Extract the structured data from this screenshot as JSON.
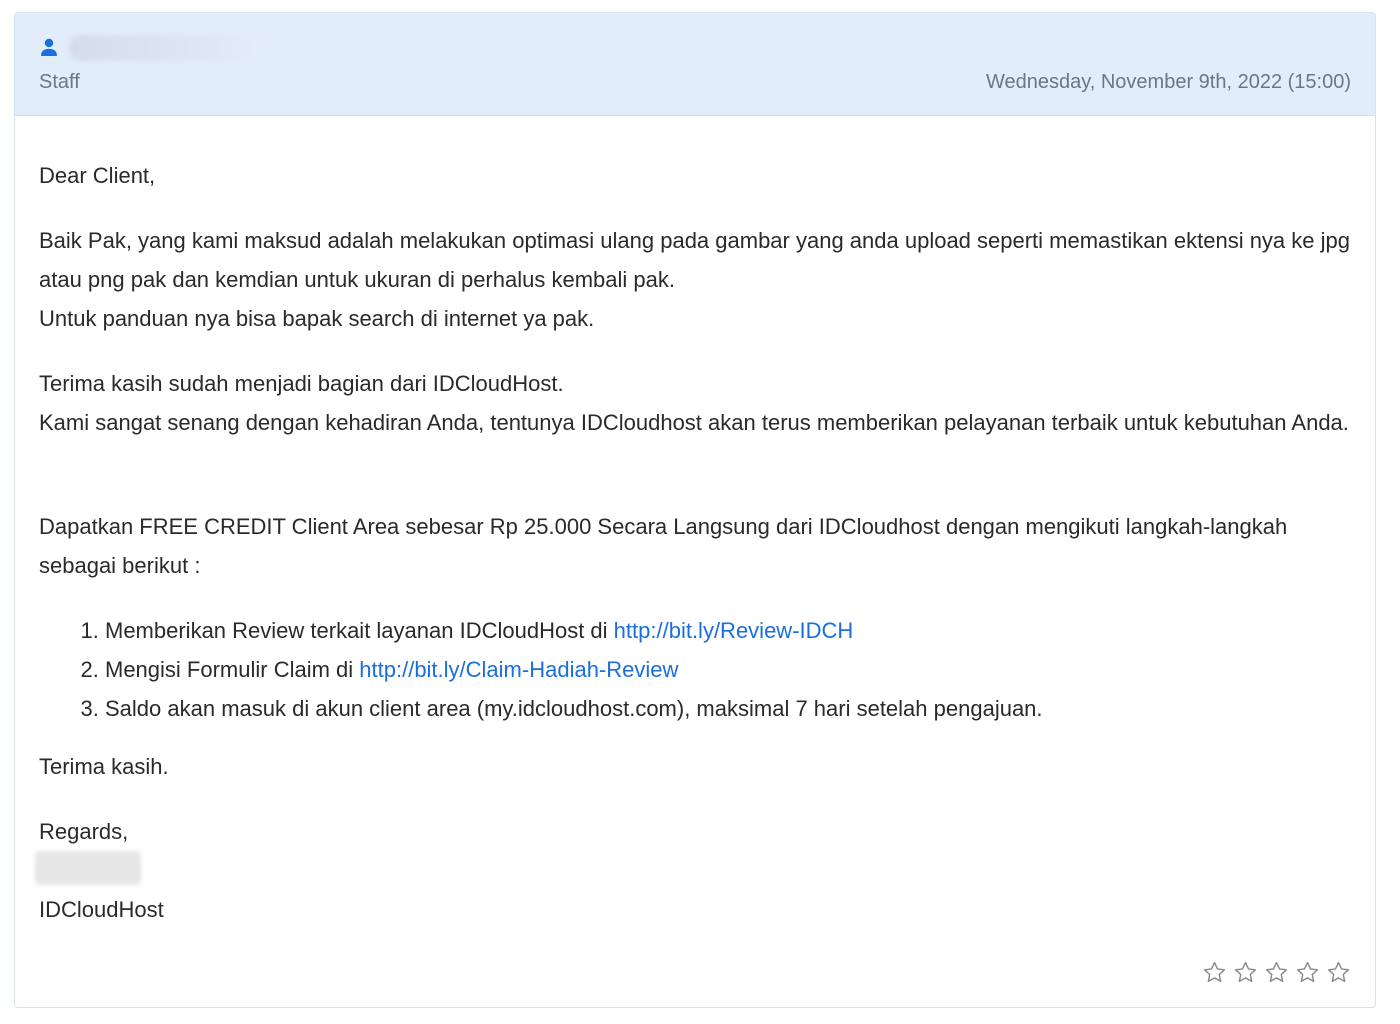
{
  "header": {
    "role": "Staff",
    "timestamp": "Wednesday, November 9th, 2022 (15:00)"
  },
  "message": {
    "greeting": "Dear Client,",
    "para1_line1": "Baik Pak, yang kami maksud adalah melakukan optimasi ulang pada gambar yang anda upload seperti memastikan ektensi nya ke jpg atau png pak dan kemdian untuk ukuran di perhalus kembali pak.",
    "para1_line2": "Untuk panduan nya bisa bapak search di internet ya pak.",
    "para2_line1": "Terima kasih sudah menjadi bagian dari IDCloudHost.",
    "para2_line2": "Kami sangat senang dengan kehadiran Anda, tentunya IDCloudhost akan terus memberikan pelayanan terbaik untuk kebutuhan Anda.",
    "para3": "Dapatkan FREE CREDIT Client Area sebesar Rp 25.000 Secara Langsung dari IDCloudhost dengan mengikuti langkah-langkah sebagai berikut :",
    "steps": [
      {
        "text": "Memberikan Review terkait layanan IDCloudHost di ",
        "link": "http://bit.ly/Review-IDCH"
      },
      {
        "text": "Mengisi Formulir Claim di ",
        "link": "http://bit.ly/Claim-Hadiah-Review"
      },
      {
        "text": "Saldo akan masuk di akun client area (my.idcloudhost.com), maksimal 7 hari setelah pengajuan.",
        "link": ""
      }
    ],
    "thanks": "Terima kasih.",
    "regards": "Regards,",
    "company": "IDCloudHost"
  },
  "rating": {
    "max_stars": 5,
    "selected": 0
  },
  "colors": {
    "header_bg": "#e2edfb",
    "link": "#1a6ee0",
    "icon": "#1a6ee0"
  },
  "icons": {
    "author": "user-icon",
    "rating": "star-outline-icon"
  }
}
